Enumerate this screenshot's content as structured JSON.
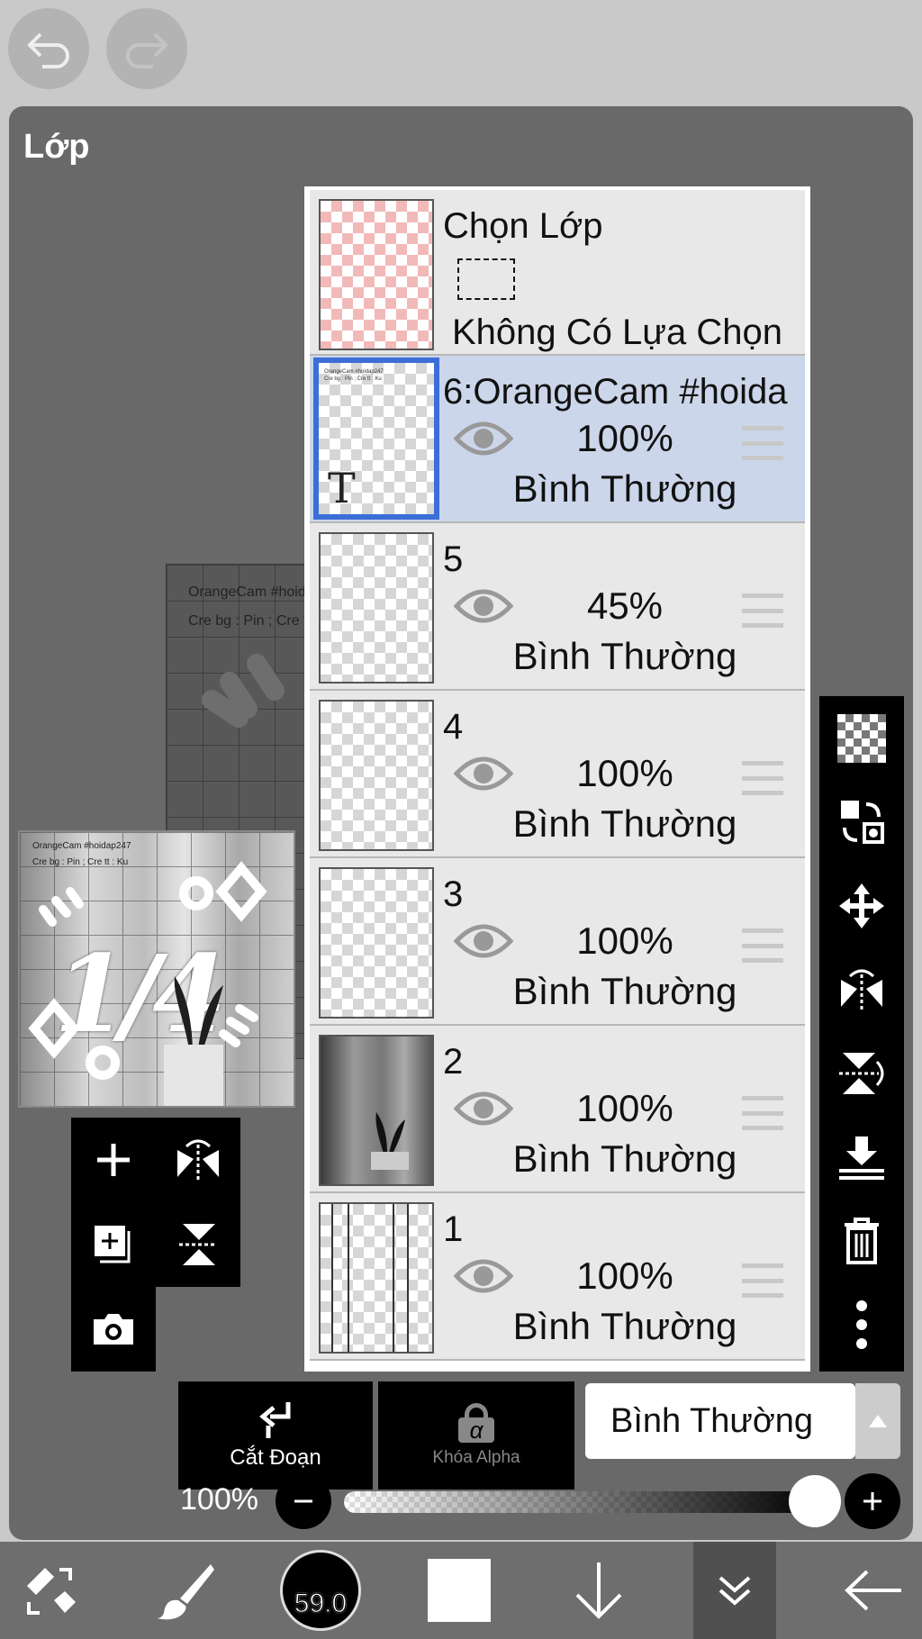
{
  "header": {
    "undo_icon": "undo-icon",
    "redo_icon": "redo-icon"
  },
  "panel": {
    "title": "Lớp"
  },
  "canvas": {
    "line1": "OrangeCam #hoid",
    "line2": "Cre bg : Pin ; Cre t"
  },
  "preview": {
    "line1": "OrangeCam #hoidap247",
    "line2": "Cre bg : Pin ; Cre tt : Ku",
    "big_text": "1/4"
  },
  "selection_layer": {
    "title": "Chọn Lớp",
    "status": "Không Có Lựa Chọn"
  },
  "layers": [
    {
      "name": "6:OrangeCam #hoida",
      "opacity": "100%",
      "blend": "Bình Thường",
      "selected": true,
      "type_mark": "T"
    },
    {
      "name": "5",
      "opacity": "45%",
      "blend": "Bình Thường",
      "selected": false
    },
    {
      "name": "4",
      "opacity": "100%",
      "blend": "Bình Thường",
      "selected": false
    },
    {
      "name": "3",
      "opacity": "100%",
      "blend": "Bình Thường",
      "selected": false
    },
    {
      "name": "2",
      "opacity": "100%",
      "blend": "Bình Thường",
      "selected": false
    },
    {
      "name": "1",
      "opacity": "100%",
      "blend": "Bình Thường",
      "selected": false
    }
  ],
  "bottom_controls": {
    "clip_label": "Cắt Đoạn",
    "alpha_lock_label": "Khóa Alpha",
    "alpha_symbol": "α",
    "blend_mode": "Bình Thường",
    "opacity_label": "100%",
    "opacity_value": 1.0
  },
  "toolbar": {
    "brush_size": "59.0"
  },
  "colors": {
    "accent": "#3c6ed8",
    "panel": "#696969",
    "selected_row": "#ccd6ea",
    "row": "#e8e8e8"
  }
}
